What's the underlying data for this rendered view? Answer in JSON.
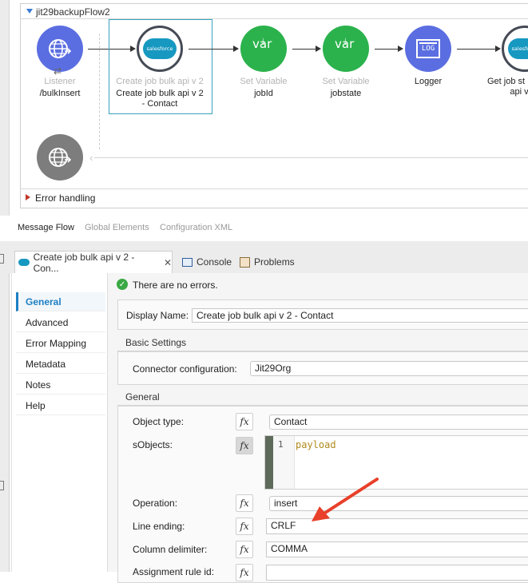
{
  "flow": {
    "title": "jit29backupFlow2",
    "nodes": [
      {
        "type_label": "Listener",
        "name": "/bulkInsert",
        "icon": "http-listener-icon"
      },
      {
        "type_label": "Create job bulk api v 2",
        "name_line1": "Create job bulk api v 2",
        "name_line2": "- Contact",
        "icon": "salesforce-icon",
        "icon_text": "salesforce"
      },
      {
        "type_label": "Set Variable",
        "name": "jobId",
        "icon": "variable-icon",
        "icon_text": "var"
      },
      {
        "type_label": "Set Variable",
        "name": "jobstate",
        "icon": "variable-icon",
        "icon_text": "var"
      },
      {
        "name": "Logger",
        "icon": "logger-icon",
        "icon_text": "LOG"
      },
      {
        "name_line1": "Get job st",
        "name_line2": "api v",
        "icon": "salesforce-icon",
        "icon_text": "salesforce"
      }
    ],
    "error_handling": "Error handling"
  },
  "view_tabs": [
    "Message Flow",
    "Global Elements",
    "Configuration XML"
  ],
  "editor_tabs": {
    "active": "Create job bulk api v 2 - Con...",
    "console": "Console",
    "problems": "Problems"
  },
  "nav": [
    "General",
    "Advanced",
    "Error Mapping",
    "Metadata",
    "Notes",
    "Help"
  ],
  "status": "There are no errors.",
  "form": {
    "display_name_label": "Display Name:",
    "display_name_value": "Create job bulk api v 2 - Contact",
    "basic_settings": "Basic Settings",
    "connector_label": "Connector configuration:",
    "connector_value": "Jit29Org",
    "general_section": "General",
    "object_type_label": "Object type:",
    "object_type_value": "Contact",
    "sobjects_label": "sObjects:",
    "sobjects_line_number": "1",
    "sobjects_code": "payload",
    "operation_label": "Operation:",
    "operation_value": "insert",
    "line_ending_label": "Line ending:",
    "line_ending_value": "CRLF",
    "column_delimiter_label": "Column delimiter:",
    "column_delimiter_value": "COMMA",
    "assignment_rule_label": "Assignment rule id:",
    "fx": "fx"
  },
  "colors": {
    "accent": "#1d7fc4",
    "annotation_arrow": "#e8402a",
    "listener": "#5b6ee1",
    "variable": "#2bb24c"
  }
}
